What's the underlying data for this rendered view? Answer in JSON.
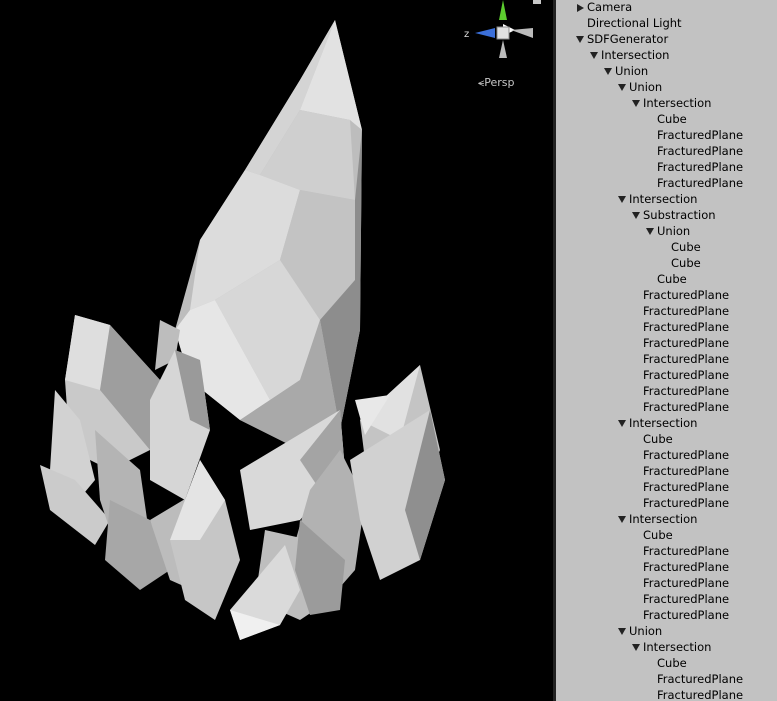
{
  "scene": {
    "view_mode": "Persp",
    "gizmo_axis_label": "z"
  },
  "hierarchy": {
    "rows": [
      {
        "label": "Camera",
        "depth": 0,
        "arrow": "right"
      },
      {
        "label": "Directional Light",
        "depth": 0,
        "arrow": "none"
      },
      {
        "label": "SDFGenerator",
        "depth": 0,
        "arrow": "down"
      },
      {
        "label": "Intersection",
        "depth": 1,
        "arrow": "down"
      },
      {
        "label": "Union",
        "depth": 2,
        "arrow": "down"
      },
      {
        "label": "Union",
        "depth": 3,
        "arrow": "down"
      },
      {
        "label": "Intersection",
        "depth": 4,
        "arrow": "down"
      },
      {
        "label": "Cube",
        "depth": 5,
        "arrow": "none"
      },
      {
        "label": "FracturedPlane",
        "depth": 5,
        "arrow": "none"
      },
      {
        "label": "FracturedPlane",
        "depth": 5,
        "arrow": "none"
      },
      {
        "label": "FracturedPlane",
        "depth": 5,
        "arrow": "none"
      },
      {
        "label": "FracturedPlane",
        "depth": 5,
        "arrow": "none"
      },
      {
        "label": "Intersection",
        "depth": 3,
        "arrow": "down"
      },
      {
        "label": "Substraction",
        "depth": 4,
        "arrow": "down"
      },
      {
        "label": "Union",
        "depth": 5,
        "arrow": "down"
      },
      {
        "label": "Cube",
        "depth": 6,
        "arrow": "none"
      },
      {
        "label": "Cube",
        "depth": 6,
        "arrow": "none"
      },
      {
        "label": "Cube",
        "depth": 5,
        "arrow": "none"
      },
      {
        "label": "FracturedPlane",
        "depth": 4,
        "arrow": "none"
      },
      {
        "label": "FracturedPlane",
        "depth": 4,
        "arrow": "none"
      },
      {
        "label": "FracturedPlane",
        "depth": 4,
        "arrow": "none"
      },
      {
        "label": "FracturedPlane",
        "depth": 4,
        "arrow": "none"
      },
      {
        "label": "FracturedPlane",
        "depth": 4,
        "arrow": "none"
      },
      {
        "label": "FracturedPlane",
        "depth": 4,
        "arrow": "none"
      },
      {
        "label": "FracturedPlane",
        "depth": 4,
        "arrow": "none"
      },
      {
        "label": "FracturedPlane",
        "depth": 4,
        "arrow": "none"
      },
      {
        "label": "Intersection",
        "depth": 3,
        "arrow": "down"
      },
      {
        "label": "Cube",
        "depth": 4,
        "arrow": "none"
      },
      {
        "label": "FracturedPlane",
        "depth": 4,
        "arrow": "none"
      },
      {
        "label": "FracturedPlane",
        "depth": 4,
        "arrow": "none"
      },
      {
        "label": "FracturedPlane",
        "depth": 4,
        "arrow": "none"
      },
      {
        "label": "FracturedPlane",
        "depth": 4,
        "arrow": "none"
      },
      {
        "label": "Intersection",
        "depth": 3,
        "arrow": "down"
      },
      {
        "label": "Cube",
        "depth": 4,
        "arrow": "none"
      },
      {
        "label": "FracturedPlane",
        "depth": 4,
        "arrow": "none"
      },
      {
        "label": "FracturedPlane",
        "depth": 4,
        "arrow": "none"
      },
      {
        "label": "FracturedPlane",
        "depth": 4,
        "arrow": "none"
      },
      {
        "label": "FracturedPlane",
        "depth": 4,
        "arrow": "none"
      },
      {
        "label": "FracturedPlane",
        "depth": 4,
        "arrow": "none"
      },
      {
        "label": "Union",
        "depth": 3,
        "arrow": "down"
      },
      {
        "label": "Intersection",
        "depth": 4,
        "arrow": "down"
      },
      {
        "label": "Cube",
        "depth": 5,
        "arrow": "none"
      },
      {
        "label": "FracturedPlane",
        "depth": 5,
        "arrow": "none"
      },
      {
        "label": "FracturedPlane",
        "depth": 5,
        "arrow": "none"
      }
    ]
  }
}
